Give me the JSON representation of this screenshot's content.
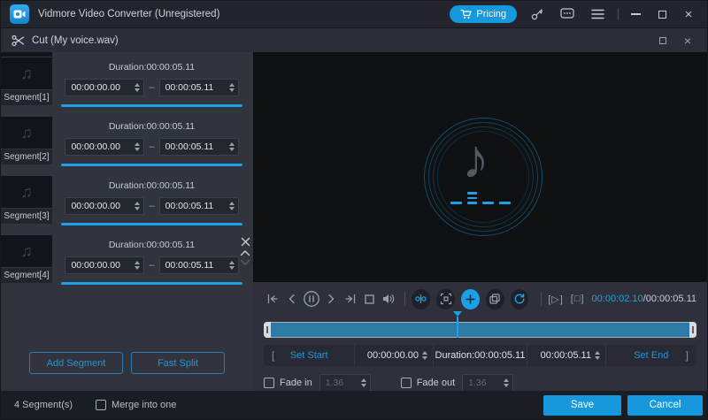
{
  "titlebar": {
    "app_title": "Vidmore Video Converter (Unregistered)",
    "pricing_label": "Pricing"
  },
  "dialog": {
    "title": "Cut (My voice.wav)"
  },
  "segments_panel": {
    "range_separator": "–",
    "items": [
      {
        "name": "Segment[1]",
        "duration": "Duration:00:00:05.11",
        "start": "00:00:00.00",
        "end": "00:00:05.11"
      },
      {
        "name": "Segment[2]",
        "duration": "Duration:00:00:05.11",
        "start": "00:00:00.00",
        "end": "00:00:05.11"
      },
      {
        "name": "Segment[3]",
        "duration": "Duration:00:00:05.11",
        "start": "00:00:00.00",
        "end": "00:00:05.11"
      },
      {
        "name": "Segment[4]",
        "duration": "Duration:00:00:05.11",
        "start": "00:00:00.00",
        "end": "00:00:05.11"
      }
    ],
    "add_segment_label": "Add Segment",
    "fast_split_label": "Fast Split"
  },
  "player": {
    "current_time": "00:00:02.10",
    "separator": "/",
    "total_time": "00:00:05.11",
    "play_segment_label": "[▷]",
    "stop_segment_label": "[□]"
  },
  "trim_bar": {
    "open_bracket": "[",
    "set_start_label": "Set Start",
    "start_value": "00:00:00.00",
    "duration_label": "Duration:00:00:05.11",
    "end_value": "00:00:05.11",
    "set_end_label": "Set End",
    "close_bracket": "]"
  },
  "fade": {
    "fade_in_label": "Fade in",
    "fade_in_value": "1.36",
    "fade_out_label": "Fade out",
    "fade_out_value": "1.36"
  },
  "footer": {
    "segment_count": "4 Segment(s)",
    "merge_label": "Merge into one",
    "save_label": "Save",
    "cancel_label": "Cancel"
  },
  "colors": {
    "accent": "#1ba1e8",
    "button_blue": "#1798dc",
    "timeline_fill": "#2d7aa6",
    "panel_bg": "#31343d",
    "preview_bg": "#0f1012",
    "footer_bg": "#1b1d24"
  }
}
